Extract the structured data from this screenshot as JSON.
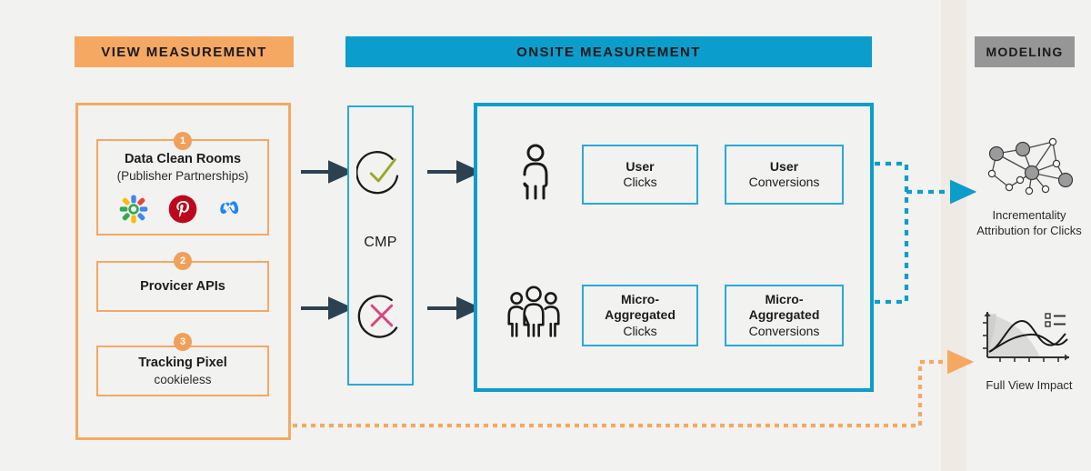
{
  "banners": {
    "view": "VIEW MEASUREMENT",
    "onsite": "ONSITE MEASUREMENT",
    "modeling": "MODELING"
  },
  "view_measurement": {
    "cards": [
      {
        "number": "1",
        "title": "Data Clean Rooms",
        "subtitle": "(Publisher Partnerships)",
        "logos": [
          "google-ads-data-hub-logo",
          "pinterest-logo",
          "meta-logo"
        ]
      },
      {
        "number": "2",
        "title": "Provicer APIs",
        "subtitle": ""
      },
      {
        "number": "3",
        "title": "Tracking Pixel",
        "subtitle": "cookieless"
      }
    ]
  },
  "cmp": {
    "label": "CMP",
    "consent_granted_icon": "check-circle-icon",
    "consent_denied_icon": "cross-circle-icon"
  },
  "onsite_measurement": {
    "rows": [
      {
        "actor_icon": "single-person-icon",
        "clicks": {
          "title": "User",
          "subtitle": "Clicks"
        },
        "conversions": {
          "title": "User",
          "subtitle": "Conversions"
        }
      },
      {
        "actor_icon": "group-of-people-icon",
        "clicks": {
          "title": "Micro-\nAggregated",
          "subtitle": "Clicks"
        },
        "conversions": {
          "title": "Micro-\nAggregated",
          "subtitle": "Conversions"
        }
      }
    ],
    "clicks_title_line1": "Micro-",
    "clicks_title_line2": "Aggregated"
  },
  "modeling": {
    "items": [
      {
        "icon": "network-graph-icon",
        "caption_line1": "Incrementality",
        "caption_line2": "Attribution for Clicks"
      },
      {
        "icon": "line-chart-icon",
        "caption_line1": "Full View Impact",
        "caption_line2": ""
      }
    ]
  },
  "colors": {
    "orange": "#f5a862",
    "orange_badge": "#f0a05a",
    "blue": "#0b9dcc",
    "blue_light": "#2aa8da",
    "gray_banner": "#969696",
    "arrow_dark": "#2d4250",
    "background": "#f2f2f1",
    "beige_band": "#efebe4",
    "check_green": "#9aa823",
    "cross_pink": "#d6487e"
  }
}
